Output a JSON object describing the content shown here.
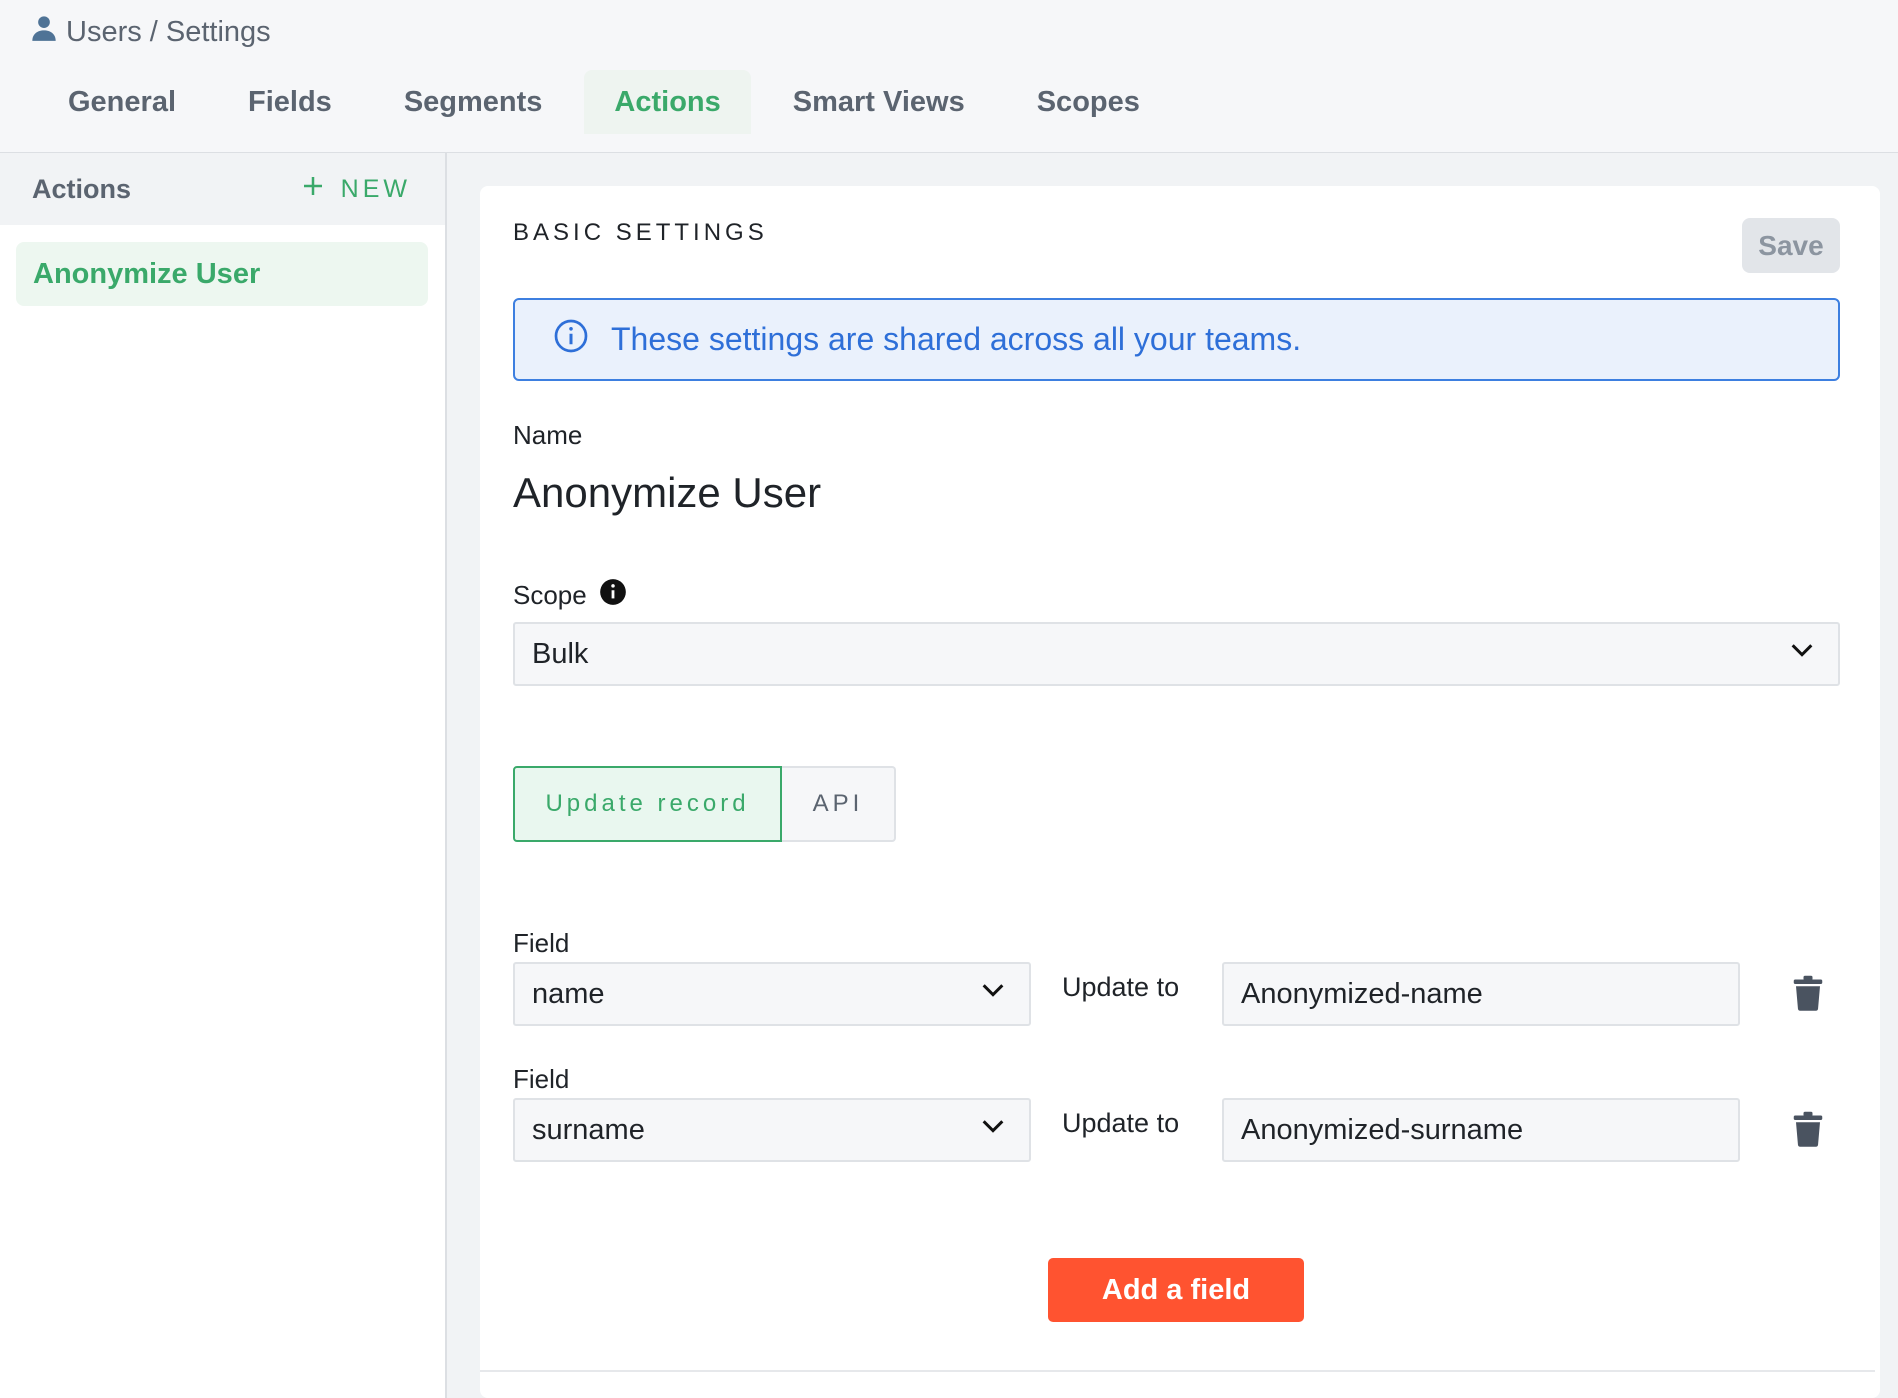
{
  "breadcrumb": {
    "icon": "user-icon",
    "text": "Users / Settings"
  },
  "tabs": [
    {
      "label": "General"
    },
    {
      "label": "Fields"
    },
    {
      "label": "Segments"
    },
    {
      "label": "Actions",
      "active": true
    },
    {
      "label": "Smart Views"
    },
    {
      "label": "Scopes"
    }
  ],
  "sidebar": {
    "title": "Actions",
    "new_label": "NEW",
    "items": [
      {
        "label": "Anonymize User",
        "selected": true
      }
    ]
  },
  "card": {
    "title": "BASIC SETTINGS",
    "save_label": "Save",
    "info_text": "These settings are shared across all your teams.",
    "name_label": "Name",
    "name_value": "Anonymize User",
    "scope_label": "Scope",
    "scope_value": "Bulk",
    "toggle": {
      "active": "Update record",
      "other": "API"
    },
    "fields": [
      {
        "label": "Field",
        "field": "name",
        "update_label": "Update to",
        "value": "Anonymized-name"
      },
      {
        "label": "Field",
        "field": "surname",
        "update_label": "Update to",
        "value": "Anonymized-surname"
      }
    ],
    "add_label": "Add a field"
  },
  "colors": {
    "accent": "#3aa96a",
    "info": "#2e6fd8",
    "add_button": "#ff5330"
  }
}
